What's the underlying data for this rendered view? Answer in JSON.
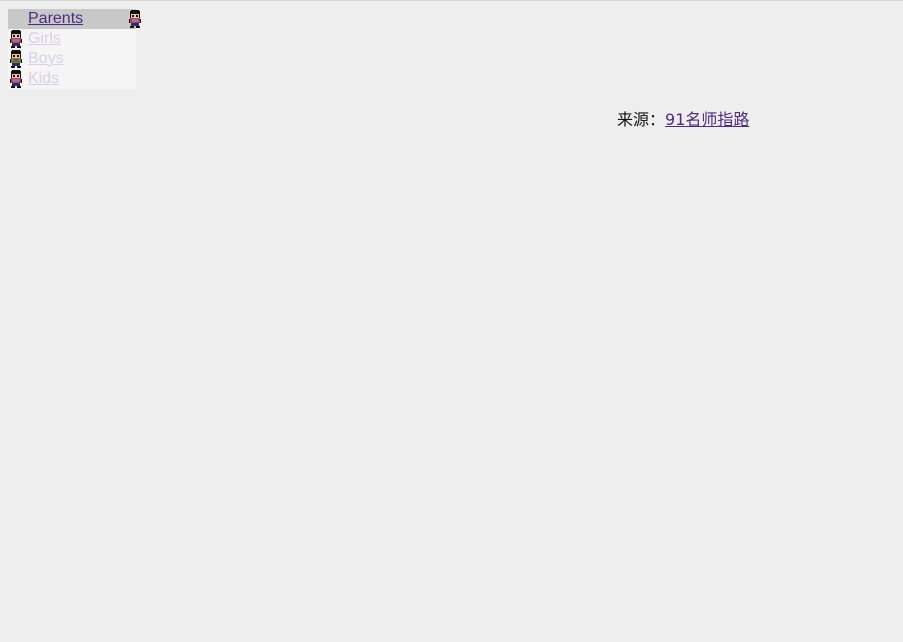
{
  "menu": {
    "items": [
      {
        "label": "Parents",
        "active": true,
        "icon": "kid-sprite-icon"
      },
      {
        "label": "Girls",
        "active": false,
        "icon": "kid-sprite-icon"
      },
      {
        "label": "Boys",
        "active": false,
        "icon": "kid-sprite-green-icon"
      },
      {
        "label": "Kids",
        "active": false,
        "icon": "kid-sprite-icon"
      }
    ]
  },
  "source": {
    "prefix": "来源：",
    "link_text": "91名师指路"
  },
  "colors": {
    "background": "#eeeeee",
    "menu_background": "#f5f5f5",
    "menu_active_background": "#c8c8c8",
    "link_visited": "#4e2a84",
    "link_faded": "#d9cfe8"
  }
}
